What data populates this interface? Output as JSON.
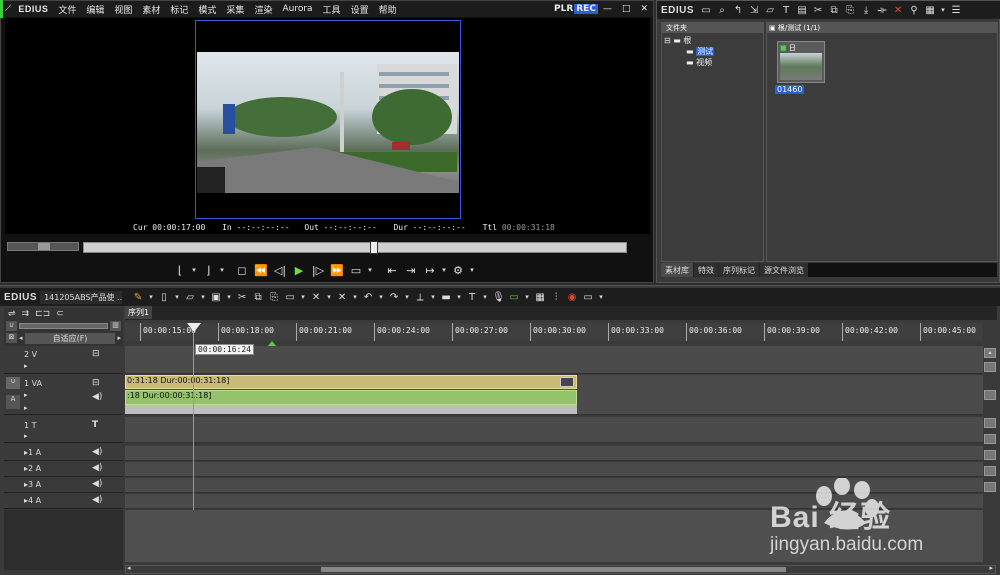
{
  "app": {
    "logo": "EDIUS",
    "menu": [
      "文件",
      "编辑",
      "视图",
      "素材",
      "标记",
      "模式",
      "采集",
      "渲染",
      "Aurora",
      "工具",
      "设置",
      "帮助"
    ],
    "plr": "PLR",
    "rec": "REC"
  },
  "timecode": {
    "cur_label": "Cur",
    "cur": "00:00:17:00",
    "in_label": "In",
    "in": "--:--:--:--",
    "out_label": "Out",
    "out": "--:--:--:--",
    "dur_label": "Dur",
    "dur": "--:--:--:--",
    "ttl_label": "Ttl",
    "ttl": "00:00:31:18"
  },
  "bin": {
    "title": "EDIUS",
    "folder_header": "文件夹",
    "tree": [
      "根",
      "测试",
      "视频"
    ],
    "clip_header": "根/测试 (1/1)",
    "clip_name": "01460",
    "clip_badge": "日",
    "tabs": [
      "素材库",
      "特效",
      "序列标记",
      "源文件浏览"
    ]
  },
  "timeline": {
    "logo": "EDIUS",
    "project": "141205ABS产品使 ...",
    "sequence_tab": "序列1",
    "track_mode": "自适应(F)",
    "ticks": [
      "00:00:15:00",
      "00:00:18:00",
      "00:00:21:00",
      "00:00:24:00",
      "00:00:27:00",
      "00:00:30:00",
      "00:00:33:00",
      "00:00:36:00",
      "00:00:39:00",
      "00:00:42:00",
      "00:00:45:00"
    ],
    "cursor_tc": "00:00:16:24",
    "tracks": {
      "v2": "2 V",
      "va1": "1 VA",
      "t1": "1 T",
      "a1": "1 A",
      "a2": "2 A",
      "a3": "3 A",
      "a4": "4 A"
    },
    "video_clip_label": "0:31:18 Dur:00:00:31:18]",
    "audio_clip_label": ":18 Dur:00:00:31:18]"
  },
  "watermark": {
    "brand": "Bai 经验",
    "url": "jingyan.baidu.com"
  },
  "colors": {
    "video_clip": "#c8bb78",
    "audio_clip": "#93c26a",
    "cursor_line": "#4ab8c8",
    "rec_bg": "#2a5fd8"
  }
}
